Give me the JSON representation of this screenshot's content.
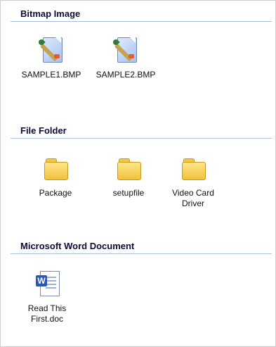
{
  "groups": [
    {
      "header": "Bitmap Image",
      "items": [
        {
          "name": "SAMPLE1.BMP",
          "icon": "bitmap-file-icon"
        },
        {
          "name": "SAMPLE2.BMP",
          "icon": "bitmap-file-icon"
        }
      ]
    },
    {
      "header": "File Folder",
      "items": [
        {
          "name": "Package",
          "icon": "folder-icon"
        },
        {
          "name": "setupfile",
          "icon": "folder-icon"
        },
        {
          "name": "Video Card Driver",
          "icon": "folder-icon"
        }
      ]
    },
    {
      "header": "Microsoft Word Document",
      "items": [
        {
          "name": "Read This First.doc",
          "icon": "word-document-icon",
          "badge": "W"
        }
      ]
    }
  ],
  "colors": {
    "header_text": "#0b0b3b",
    "header_rule": "#a9bfe0",
    "background": "#ffffff",
    "folder": "#f1c23a",
    "word_blue": "#2b58b4"
  }
}
